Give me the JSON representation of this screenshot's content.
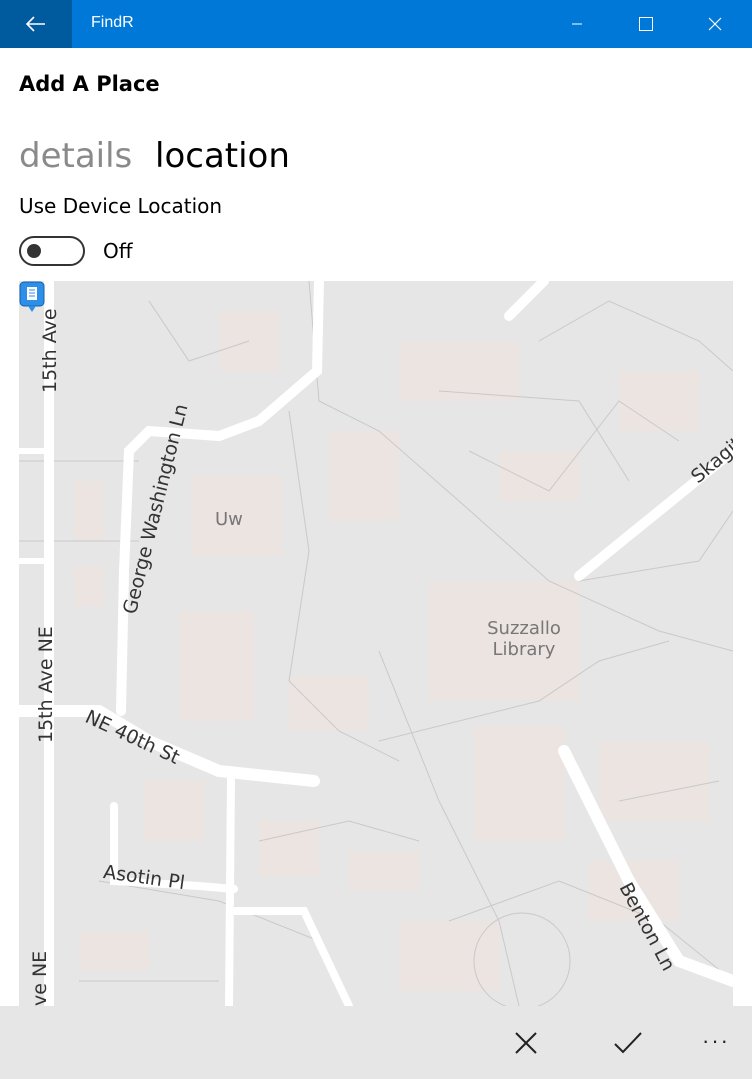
{
  "window": {
    "app_title": "FindR"
  },
  "page": {
    "title": "Add A Place",
    "tabs": [
      {
        "label": "details",
        "active": false
      },
      {
        "label": "location",
        "active": true
      }
    ],
    "device_location": {
      "label": "Use Device Location",
      "toggle_state": "Off"
    }
  },
  "map": {
    "streets": [
      "15th Ave",
      "George Washington Ln",
      "15th Ave NE",
      "NE 40th St",
      "Asotin Pl",
      "Benton Ln",
      "Skagit",
      "ve NE"
    ],
    "places": [
      {
        "name": "Uw"
      },
      {
        "name": "Suzzallo Library"
      }
    ],
    "pin_icon": "map-pin-icon"
  },
  "command_bar": {
    "cancel_icon": "close-icon",
    "accept_icon": "checkmark-icon",
    "more_label": "···"
  },
  "colors": {
    "titlebar": "#0078d7",
    "back_button": "#005a9e",
    "map_bg": "#e6e6e6",
    "pin": "#2d8fe8"
  }
}
